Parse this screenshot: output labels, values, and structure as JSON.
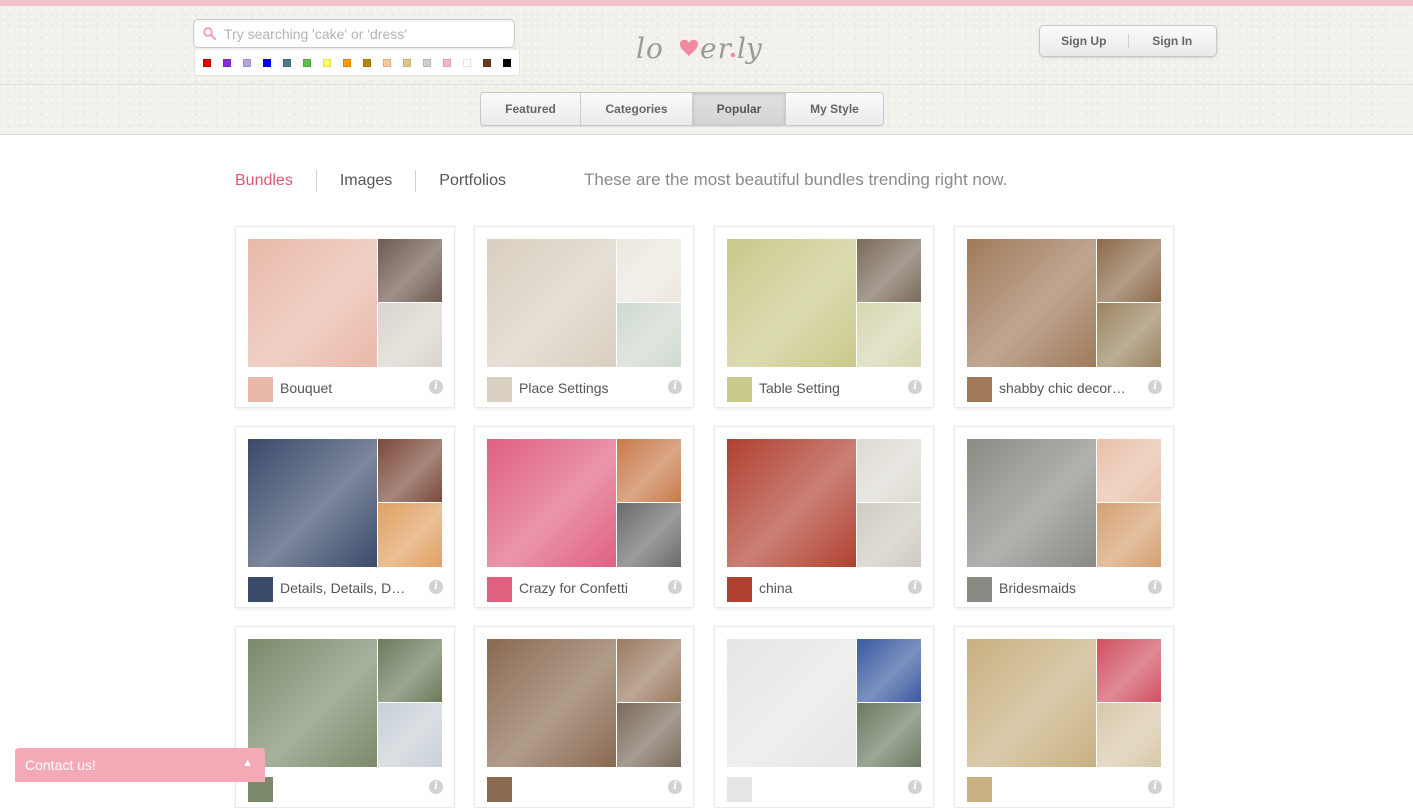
{
  "search": {
    "placeholder": "Try searching 'cake' or 'dress'"
  },
  "color_swatches": [
    "#e60000",
    "#8a2be2",
    "#b9a6d9",
    "#0000ff",
    "#4a7d8c",
    "#5cbf4c",
    "#ffff66",
    "#ff9900",
    "#b8860b",
    "#f5c89a",
    "#e0c68a",
    "#cfcfcf",
    "#f7b6c2",
    "#ffffff",
    "#6b3a1a",
    "#000000"
  ],
  "logo": {
    "text": "lover.ly",
    "accent": "#f08aa0"
  },
  "auth": {
    "signup_label": "Sign Up",
    "signin_label": "Sign In"
  },
  "nav": {
    "tabs": [
      {
        "label": "Featured"
      },
      {
        "label": "Categories"
      },
      {
        "label": "Popular",
        "active": true
      },
      {
        "label": "My Style"
      }
    ]
  },
  "subnav": {
    "items": [
      {
        "label": "Bundles",
        "active": true
      },
      {
        "label": "Images"
      },
      {
        "label": "Portfolios"
      }
    ],
    "tagline": "These are the most beautiful bundles trending right now."
  },
  "bundles": [
    {
      "title": "Bouquet",
      "colors": [
        "#e8b9a8",
        "#6e5a50",
        "#d9d4cc"
      ]
    },
    {
      "title": "Place Settings",
      "colors": [
        "#d9cfc0",
        "#ece7df",
        "#cfd9cf"
      ]
    },
    {
      "title": "Table Setting",
      "colors": [
        "#c9c98a",
        "#7a6a5a",
        "#d6d6b0"
      ]
    },
    {
      "title": "shabby chic decor…",
      "colors": [
        "#a07a5a",
        "#8c6a4a",
        "#9a8460"
      ]
    },
    {
      "title": "Details, Details, D…",
      "colors": [
        "#3a4a6a",
        "#7a4a3a",
        "#e0a060"
      ]
    },
    {
      "title": "Crazy for Confetti",
      "colors": [
        "#e06080",
        "#c87a4a",
        "#6a6a6a"
      ]
    },
    {
      "title": "china",
      "colors": [
        "#b04030",
        "#dddad2",
        "#cfcac0"
      ]
    },
    {
      "title": "Bridesmaids",
      "colors": [
        "#8a8a85",
        "#e8c0a8",
        "#d4a070"
      ]
    },
    {
      "title": "",
      "colors": [
        "#7a8a6a",
        "#6a7a5a",
        "#c8d0d6"
      ]
    },
    {
      "title": "",
      "colors": [
        "#8a6a50",
        "#9a7a60",
        "#7a6a5a"
      ]
    },
    {
      "title": "",
      "colors": [
        "#e6e6e6",
        "#3a5aa0",
        "#6a7a60"
      ]
    },
    {
      "title": "",
      "colors": [
        "#c8b080",
        "#d05060",
        "#d8c8a8"
      ]
    }
  ],
  "contact": {
    "label": "Contact us!"
  }
}
